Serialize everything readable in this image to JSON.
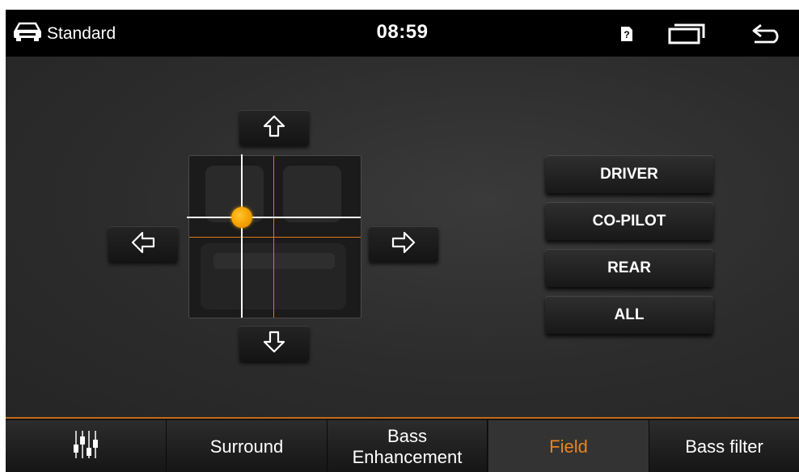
{
  "status_bar": {
    "mode_icon": "car-icon",
    "mode_label": "Standard",
    "time": "08:59",
    "sim_icon": "sim-card-question-icon",
    "recent_apps_icon": "recent-apps-icon",
    "back_icon": "back-arrow-icon"
  },
  "field_control": {
    "up_icon": "arrow-up-icon",
    "down_icon": "arrow-down-icon",
    "left_icon": "arrow-left-icon",
    "right_icon": "arrow-right-icon",
    "focus_marker_color": "#f5a000",
    "guide_line_color": "#e07a10"
  },
  "seat_buttons": [
    {
      "label": "DRIVER"
    },
    {
      "label": "CO-PILOT"
    },
    {
      "label": "REAR"
    },
    {
      "label": "ALL"
    }
  ],
  "tabs": [
    {
      "label": "",
      "icon": "equalizer-icon"
    },
    {
      "label": "Surround"
    },
    {
      "label": "Bass Enhancement"
    },
    {
      "label": "Field",
      "active": true
    },
    {
      "label": "Bass filter"
    }
  ],
  "colors": {
    "accent": "#e8841f",
    "background": "#2b2b2b",
    "statusbar": "#000000"
  }
}
